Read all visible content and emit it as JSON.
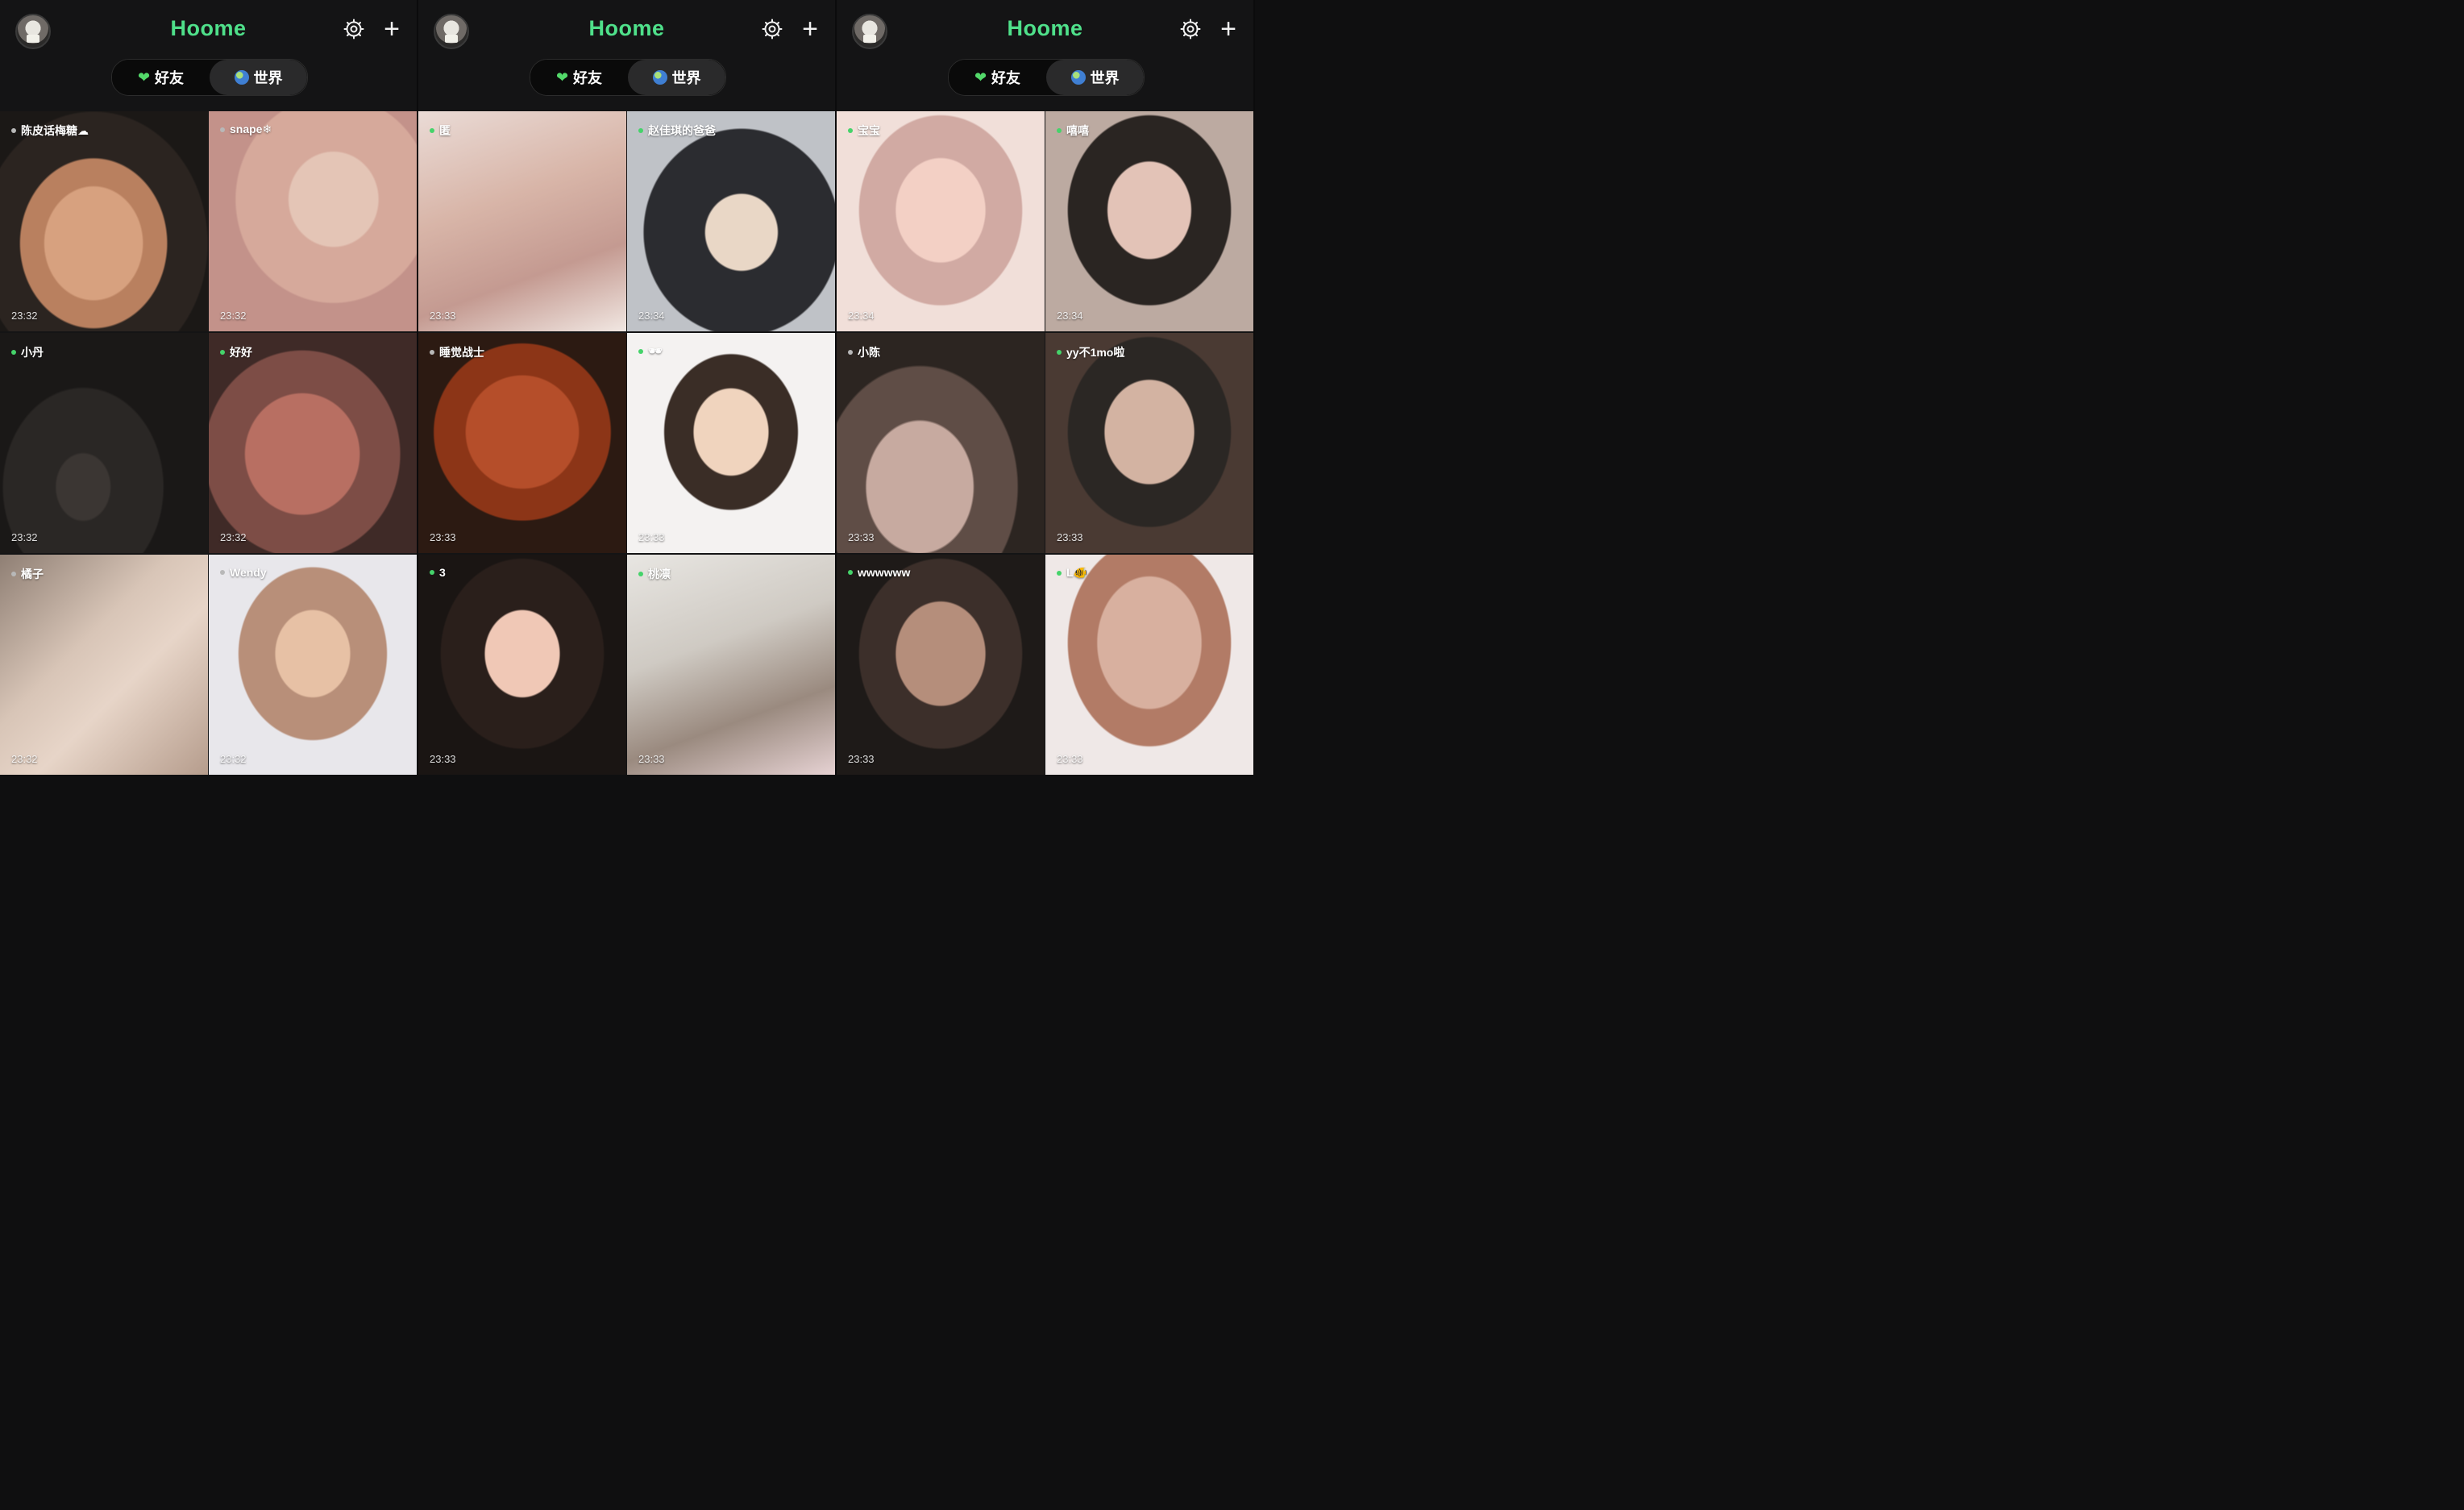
{
  "app": {
    "name": "Hoome",
    "brand_color": "#4fe08a",
    "accent_heart": "#53d96a"
  },
  "panels": [
    {
      "header": {
        "title": "Hoome",
        "tabs": [
          {
            "label": "好友",
            "icon": "heart-icon",
            "active": true
          },
          {
            "label": "世界",
            "icon": "globe-icon",
            "active": false
          }
        ],
        "settings_icon": "gear-icon",
        "add_icon": "plus-icon"
      },
      "tiles": [
        {
          "name": "陈皮话梅糖☁",
          "time": "23:32",
          "dot_color": "#b8b8b8"
        },
        {
          "name": "snape❄",
          "time": "23:32",
          "dot_color": "#b8b8b8"
        },
        {
          "name": "小丹",
          "time": "23:32",
          "dot_color": "#45d36a"
        },
        {
          "name": "好好",
          "time": "23:32",
          "dot_color": "#45d36a"
        },
        {
          "name": "橘子",
          "time": "23:32",
          "dot_color": "#b8b8b8"
        },
        {
          "name": "Wendy",
          "time": "23:32",
          "dot_color": "#b8b8b8"
        }
      ]
    },
    {
      "header": {
        "title": "Hoome",
        "tabs": [
          {
            "label": "好友",
            "icon": "heart-icon",
            "active": true
          },
          {
            "label": "世界",
            "icon": "globe-icon",
            "active": false
          }
        ],
        "settings_icon": "gear-icon",
        "add_icon": "plus-icon"
      },
      "tiles": [
        {
          "name": "匿",
          "time": "23:33",
          "dot_color": "#45d36a"
        },
        {
          "name": "赵佳琪的爸爸",
          "time": "23:34",
          "dot_color": "#45d36a"
        },
        {
          "name": "睡觉战士",
          "time": "23:33",
          "dot_color": "#b8b8b8"
        },
        {
          "name": "🕶",
          "time": "23:33",
          "dot_color": "#45d36a"
        },
        {
          "name": "3",
          "time": "23:33",
          "dot_color": "#45d36a"
        },
        {
          "name": "桃凛",
          "time": "23:33",
          "dot_color": "#45d36a"
        }
      ]
    },
    {
      "header": {
        "title": "Hoome",
        "tabs": [
          {
            "label": "好友",
            "icon": "heart-icon",
            "active": true
          },
          {
            "label": "世界",
            "icon": "globe-icon",
            "active": false
          }
        ],
        "settings_icon": "gear-icon",
        "add_icon": "plus-icon"
      },
      "tiles": [
        {
          "name": "宝宝",
          "time": "23:34",
          "dot_color": "#45d36a"
        },
        {
          "name": "嘻嘻",
          "time": "23:34",
          "dot_color": "#45d36a"
        },
        {
          "name": "小陈",
          "time": "23:33",
          "dot_color": "#b8b8b8"
        },
        {
          "name": "yy不1mo啦",
          "time": "23:33",
          "dot_color": "#45d36a"
        },
        {
          "name": "wwwwww",
          "time": "23:33",
          "dot_color": "#45d36a"
        },
        {
          "name": "L🐠",
          "time": "23:33",
          "dot_color": "#45d36a"
        }
      ]
    }
  ]
}
